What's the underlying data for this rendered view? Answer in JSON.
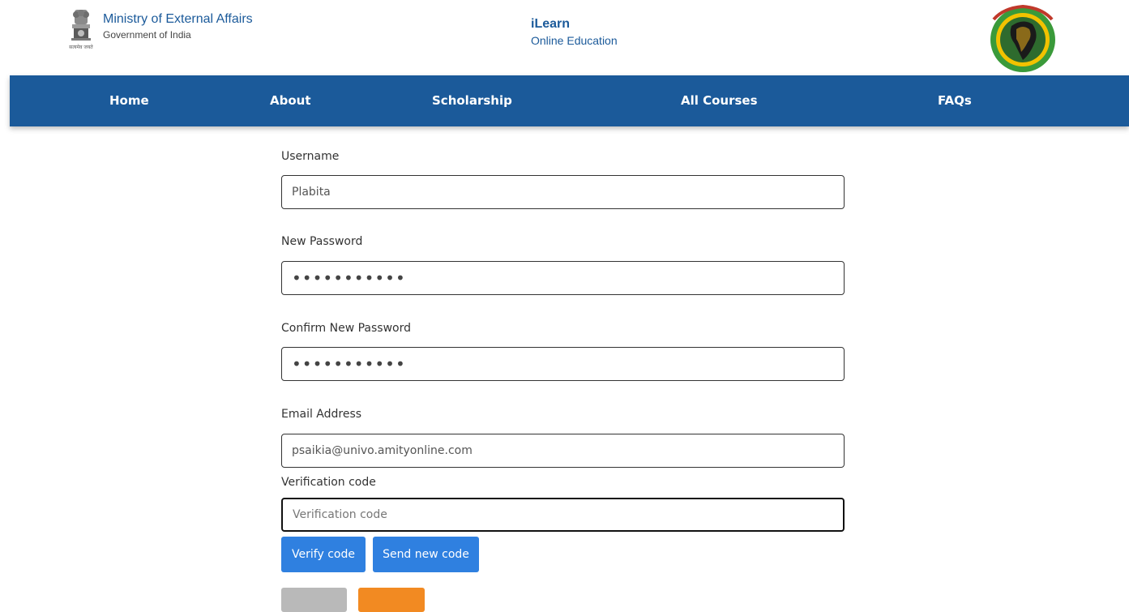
{
  "header": {
    "brand_title": "Ministry of External Affairs",
    "brand_subtitle": "Government of India",
    "emblem_caption": "सत्यमेव जयते",
    "center_title": "iLearn",
    "center_subtitle": "Online Education"
  },
  "nav": {
    "items": [
      {
        "label": "Home"
      },
      {
        "label": "About"
      },
      {
        "label": "Scholarship"
      },
      {
        "label": "All Courses"
      },
      {
        "label": "FAQs"
      }
    ]
  },
  "form": {
    "username_label": "Username",
    "username_value": "Plabita",
    "new_password_label": "New Password",
    "new_password_value": "•••••••••••",
    "confirm_password_label": "Confirm New Password",
    "confirm_password_value": "•••••••••••",
    "email_label": "Email Address",
    "email_value": "psaikia@univo.amityonline.com",
    "verification_label": "Verification code",
    "verification_placeholder": "Verification code",
    "verify_button": "Verify code",
    "send_button": "Send new code"
  },
  "colors": {
    "brand_blue": "#1b5a9a",
    "button_blue": "#2f80e0",
    "button_gray": "#b9b9b9",
    "button_orange": "#f28a22"
  }
}
